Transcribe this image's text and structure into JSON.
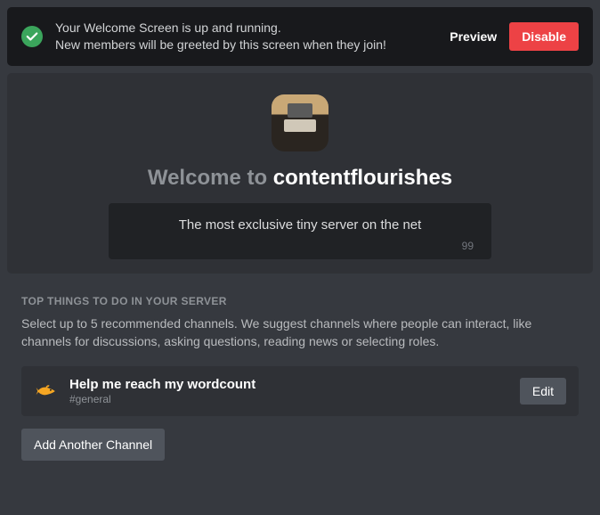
{
  "notice": {
    "line1": "Your Welcome Screen is up and running.",
    "line2": "New members will be greeted by this screen when they join!",
    "preview_label": "Preview",
    "disable_label": "Disable"
  },
  "welcome": {
    "prefix": "Welcome to ",
    "server_name": "contentflourishes",
    "description": "The most exclusive tiny server on the net",
    "char_count": "99"
  },
  "section": {
    "heading": "TOP THINGS TO DO IN YOUR SERVER",
    "description": "Select up to 5 recommended channels. We suggest channels where people can interact, like channels for discussions, asking questions, reading news or selecting roles."
  },
  "channels": [
    {
      "title": "Help me reach my wordcount",
      "name": "#general",
      "edit_label": "Edit"
    }
  ],
  "add_label": "Add Another Channel"
}
